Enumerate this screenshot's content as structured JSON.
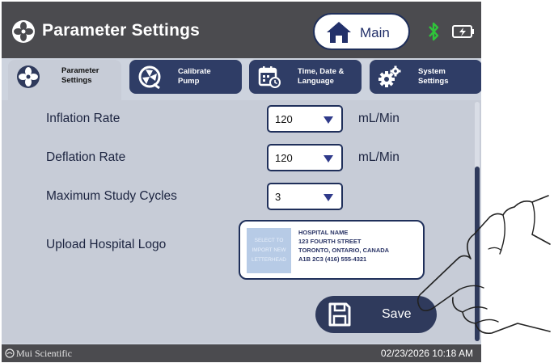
{
  "header": {
    "title": "Parameter Settings",
    "main_label": "Main",
    "icons": [
      "fan-icon",
      "home-icon",
      "bluetooth-icon",
      "battery-charging-icon"
    ]
  },
  "tabs": [
    {
      "label": "Parameter\nSettings",
      "icon": "fan-icon",
      "active": true
    },
    {
      "label": "Calibrate\nPump",
      "icon": "calibrate-icon",
      "active": false
    },
    {
      "label": "Time, Date &\nLanguage",
      "icon": "calendar-icon",
      "active": false
    },
    {
      "label": "System\nSettings",
      "icon": "gears-icon",
      "active": false
    }
  ],
  "settings": {
    "inflation": {
      "label": "Inflation Rate",
      "value": "120",
      "unit": "mL/Min"
    },
    "deflation": {
      "label": "Deflation Rate",
      "value": "120",
      "unit": "mL/Min"
    },
    "cycles": {
      "label": "Maximum Study Cycles",
      "value": "3"
    },
    "logo": {
      "label": "Upload Hospital Logo",
      "placeholder": "SELECT TO IMPORT NEW LETTERHEAD",
      "address": "HOSPITAL NAME\n123 FOURTH STREET\nTORONTO, ONTARIO, CANADA\nA1B 2C3  (416) 555-4321"
    }
  },
  "save_label": "Save",
  "footer": {
    "brand": "Mui Scientific",
    "datetime": "02/23/2026 10:18 AM"
  },
  "colors": {
    "titlebar": "#4b4b4f",
    "navy": "#2f3a5c",
    "panel": "#c7ccd7",
    "bluetooth": "#2fc43a"
  }
}
